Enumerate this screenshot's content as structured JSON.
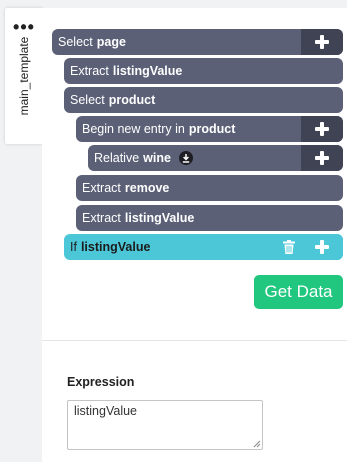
{
  "side_tab": {
    "menu_icon": "more-dots-icon",
    "label": "main_template"
  },
  "commands": [
    {
      "action": "Select",
      "target": "page",
      "icon": "plus-icon"
    },
    {
      "action": "Extract",
      "target": "listingValue"
    },
    {
      "action": "Select",
      "target": "product"
    },
    {
      "action": "Begin new entry in",
      "target": "product",
      "icon": "plus-icon"
    },
    {
      "action": "Relative",
      "target": "wine",
      "extra_icon": "download-icon",
      "icon": "plus-icon"
    },
    {
      "action": "Extract",
      "target": "remove"
    },
    {
      "action": "Extract",
      "target": "listingValue"
    },
    {
      "action": "If",
      "target": "listingValue",
      "extra_icon": "trash-icon",
      "icon": "plus-icon"
    }
  ],
  "get_data_label": "Get Data",
  "expression": {
    "label": "Expression",
    "value": "listingValue"
  },
  "colors": {
    "command_bg": "#5b6076",
    "command_plus_bg": "#3f4353",
    "if_bg": "#4bc7d8",
    "get_data_bg": "#21c67f"
  }
}
